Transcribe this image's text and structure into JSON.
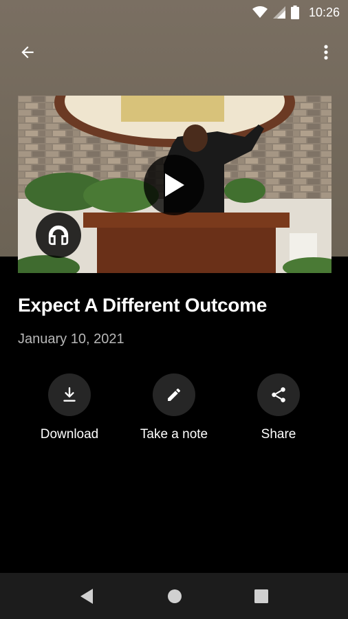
{
  "status_bar": {
    "time": "10:26",
    "icons": [
      "wifi-icon",
      "signal-icon",
      "battery-icon"
    ]
  },
  "app_bar": {
    "back_icon": "arrow-back-icon",
    "menu_icon": "more-vertical-icon"
  },
  "media": {
    "play_icon": "play-icon",
    "audio_icon": "headphones-icon"
  },
  "sermon": {
    "title": "Expect A Different Outcome",
    "date": "January 10, 2021"
  },
  "actions": [
    {
      "label": "Download",
      "icon": "download-icon"
    },
    {
      "label": "Take a note",
      "icon": "pencil-icon"
    },
    {
      "label": "Share",
      "icon": "share-icon"
    }
  ],
  "nav": {
    "items": [
      "back-triangle-icon",
      "home-circle-icon",
      "recents-square-icon"
    ]
  },
  "colors": {
    "header_bg": "#7a6f62",
    "page_bg": "#000000",
    "action_circle": "#262626",
    "nav_bg": "#1c1c1c",
    "date_text": "#b8b8b8"
  }
}
